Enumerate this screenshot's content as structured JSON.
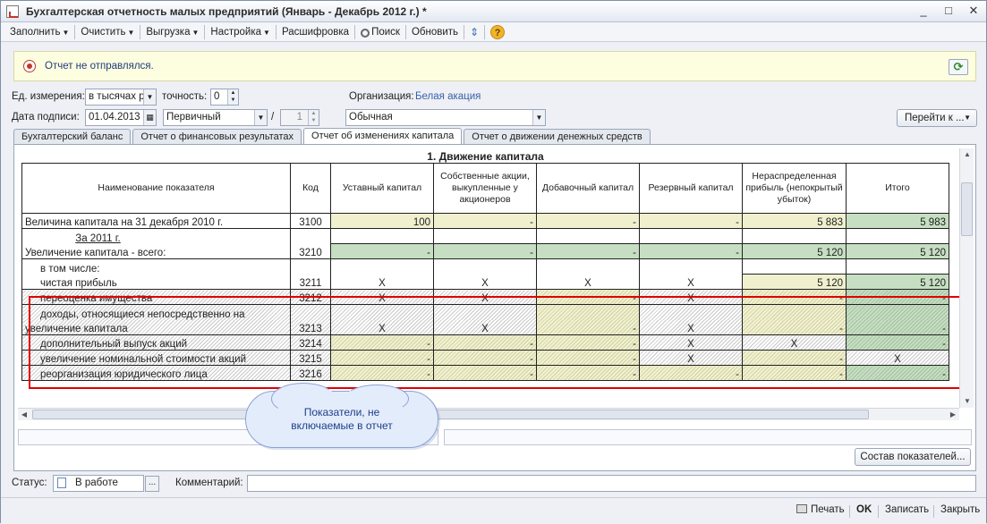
{
  "window": {
    "title": "Бухгалтерская отчетность малых предприятий (Январь - Декабрь 2012 г.) *",
    "controls": [
      "_",
      "□",
      "✕"
    ]
  },
  "toolbar": {
    "fill": "Заполнить",
    "clear": "Очистить",
    "export": "Выгрузка",
    "settings": "Настройка",
    "breakdown": "Расшифровка",
    "search": "Поиск",
    "refresh": "Обновить",
    "help": "?"
  },
  "info": {
    "text": "Отчет не отправлялся."
  },
  "form": {
    "unit_label": "Ед. измерения:",
    "unit_value": "в тысячах р",
    "precision_label": "точность:",
    "precision_value": "0",
    "org_label": "Организация:",
    "org_value": "Белая акация",
    "date_label": "Дата подписи:",
    "date_value": "01.04.2013",
    "type_value": "Первичный",
    "slash": "/",
    "correction_number": "1",
    "kind_value": "Обычная",
    "goto_label": "Перейти к ..."
  },
  "tabs": [
    {
      "label": "Бухгалтерский баланс"
    },
    {
      "label": "Отчет о финансовых результатах"
    },
    {
      "label": "Отчет об изменениях капитала"
    },
    {
      "label": "Отчет о движении денежных средств"
    }
  ],
  "grid": {
    "title": "1. Движение капитала",
    "headers": [
      "Наименование показателя",
      "Код",
      "Уставный капитал",
      "Собственные акции, выкупленные у акционеров",
      "Добавочный капитал",
      "Резервный капитал",
      "Нераспределенная прибыль (непокрытый убыток)",
      "Итого"
    ],
    "rows": {
      "r3100": {
        "name": "Величина капитала на 31 декабря 2010 г.",
        "code": "3100",
        "c1": "100",
        "c2": "-",
        "c3": "-",
        "c4": "-",
        "c5": "5 883",
        "c6": "5 983"
      },
      "year": {
        "name": "За 2011 г."
      },
      "r3210": {
        "name": "Увеличение капитала - всего:",
        "code": "3210",
        "c1": "-",
        "c2": "-",
        "c3": "-",
        "c4": "-",
        "c5": "5 120",
        "c6": "5 120"
      },
      "incl": {
        "name": "в том числе:"
      },
      "r3211": {
        "name": "чистая прибыль",
        "code": "3211",
        "c1": "X",
        "c2": "X",
        "c3": "X",
        "c4": "X",
        "c5": "5 120",
        "c6": "5 120"
      },
      "r3212": {
        "name": "переоценка имущества",
        "code": "3212",
        "c1": "X",
        "c2": "X",
        "c3": "-",
        "c4": "X",
        "c5": "-",
        "c6": "-"
      },
      "r3213a": {
        "name": "доходы, относящиеся непосредственно на"
      },
      "r3213": {
        "name": "увеличение капитала",
        "code": "3213",
        "c1": "X",
        "c2": "X",
        "c3": "-",
        "c4": "X",
        "c5": "-",
        "c6": "-"
      },
      "r3214": {
        "name": "дополнительный выпуск акций",
        "code": "3214",
        "c1": "-",
        "c2": "-",
        "c3": "-",
        "c4": "X",
        "c5": "X",
        "c6": "-"
      },
      "r3215": {
        "name": "увеличение номинальной стоимости акций",
        "code": "3215",
        "c1": "-",
        "c2": "-",
        "c3": "-",
        "c4": "X",
        "c5": "-",
        "c6": "X"
      },
      "r3216": {
        "name": "реорганизация юридического лица",
        "code": "3216",
        "c1": "-",
        "c2": "-",
        "c3": "-",
        "c4": "-",
        "c5": "-",
        "c6": "-"
      }
    }
  },
  "callout": {
    "text": "Показатели, не\nвключаемые в отчет"
  },
  "composition_button": "Состав показателей...",
  "status": {
    "label": "Статус:",
    "value": "В работе",
    "ellipsis": "...",
    "comment_label": "Комментарий:",
    "comment_value": ""
  },
  "bottom": {
    "print": "Печать",
    "ok": "OK",
    "save": "Записать",
    "close": "Закрыть"
  }
}
